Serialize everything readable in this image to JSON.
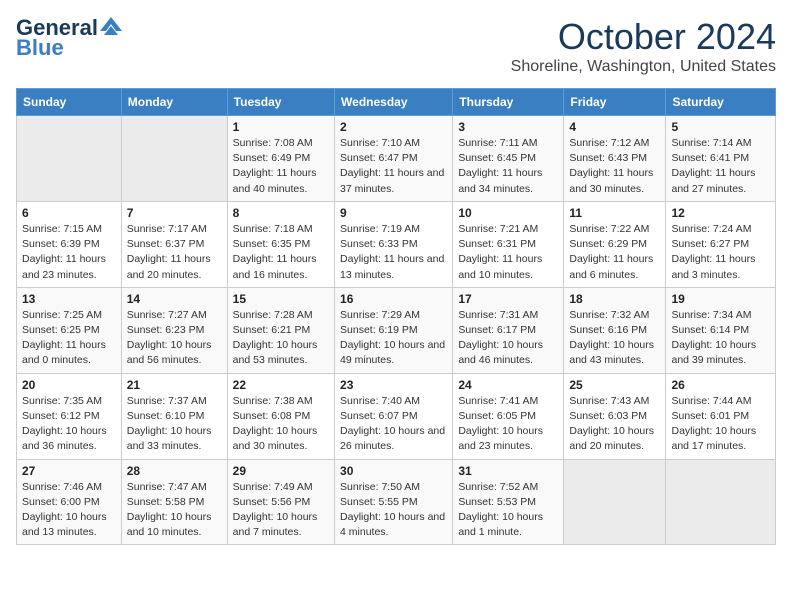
{
  "logo": {
    "line1": "General",
    "line2": "Blue"
  },
  "title": "October 2024",
  "subtitle": "Shoreline, Washington, United States",
  "days_of_week": [
    "Sunday",
    "Monday",
    "Tuesday",
    "Wednesday",
    "Thursday",
    "Friday",
    "Saturday"
  ],
  "weeks": [
    [
      {
        "day": "",
        "info": ""
      },
      {
        "day": "",
        "info": ""
      },
      {
        "day": "1",
        "info": "Sunrise: 7:08 AM\nSunset: 6:49 PM\nDaylight: 11 hours and 40 minutes."
      },
      {
        "day": "2",
        "info": "Sunrise: 7:10 AM\nSunset: 6:47 PM\nDaylight: 11 hours and 37 minutes."
      },
      {
        "day": "3",
        "info": "Sunrise: 7:11 AM\nSunset: 6:45 PM\nDaylight: 11 hours and 34 minutes."
      },
      {
        "day": "4",
        "info": "Sunrise: 7:12 AM\nSunset: 6:43 PM\nDaylight: 11 hours and 30 minutes."
      },
      {
        "day": "5",
        "info": "Sunrise: 7:14 AM\nSunset: 6:41 PM\nDaylight: 11 hours and 27 minutes."
      }
    ],
    [
      {
        "day": "6",
        "info": "Sunrise: 7:15 AM\nSunset: 6:39 PM\nDaylight: 11 hours and 23 minutes."
      },
      {
        "day": "7",
        "info": "Sunrise: 7:17 AM\nSunset: 6:37 PM\nDaylight: 11 hours and 20 minutes."
      },
      {
        "day": "8",
        "info": "Sunrise: 7:18 AM\nSunset: 6:35 PM\nDaylight: 11 hours and 16 minutes."
      },
      {
        "day": "9",
        "info": "Sunrise: 7:19 AM\nSunset: 6:33 PM\nDaylight: 11 hours and 13 minutes."
      },
      {
        "day": "10",
        "info": "Sunrise: 7:21 AM\nSunset: 6:31 PM\nDaylight: 11 hours and 10 minutes."
      },
      {
        "day": "11",
        "info": "Sunrise: 7:22 AM\nSunset: 6:29 PM\nDaylight: 11 hours and 6 minutes."
      },
      {
        "day": "12",
        "info": "Sunrise: 7:24 AM\nSunset: 6:27 PM\nDaylight: 11 hours and 3 minutes."
      }
    ],
    [
      {
        "day": "13",
        "info": "Sunrise: 7:25 AM\nSunset: 6:25 PM\nDaylight: 11 hours and 0 minutes."
      },
      {
        "day": "14",
        "info": "Sunrise: 7:27 AM\nSunset: 6:23 PM\nDaylight: 10 hours and 56 minutes."
      },
      {
        "day": "15",
        "info": "Sunrise: 7:28 AM\nSunset: 6:21 PM\nDaylight: 10 hours and 53 minutes."
      },
      {
        "day": "16",
        "info": "Sunrise: 7:29 AM\nSunset: 6:19 PM\nDaylight: 10 hours and 49 minutes."
      },
      {
        "day": "17",
        "info": "Sunrise: 7:31 AM\nSunset: 6:17 PM\nDaylight: 10 hours and 46 minutes."
      },
      {
        "day": "18",
        "info": "Sunrise: 7:32 AM\nSunset: 6:16 PM\nDaylight: 10 hours and 43 minutes."
      },
      {
        "day": "19",
        "info": "Sunrise: 7:34 AM\nSunset: 6:14 PM\nDaylight: 10 hours and 39 minutes."
      }
    ],
    [
      {
        "day": "20",
        "info": "Sunrise: 7:35 AM\nSunset: 6:12 PM\nDaylight: 10 hours and 36 minutes."
      },
      {
        "day": "21",
        "info": "Sunrise: 7:37 AM\nSunset: 6:10 PM\nDaylight: 10 hours and 33 minutes."
      },
      {
        "day": "22",
        "info": "Sunrise: 7:38 AM\nSunset: 6:08 PM\nDaylight: 10 hours and 30 minutes."
      },
      {
        "day": "23",
        "info": "Sunrise: 7:40 AM\nSunset: 6:07 PM\nDaylight: 10 hours and 26 minutes."
      },
      {
        "day": "24",
        "info": "Sunrise: 7:41 AM\nSunset: 6:05 PM\nDaylight: 10 hours and 23 minutes."
      },
      {
        "day": "25",
        "info": "Sunrise: 7:43 AM\nSunset: 6:03 PM\nDaylight: 10 hours and 20 minutes."
      },
      {
        "day": "26",
        "info": "Sunrise: 7:44 AM\nSunset: 6:01 PM\nDaylight: 10 hours and 17 minutes."
      }
    ],
    [
      {
        "day": "27",
        "info": "Sunrise: 7:46 AM\nSunset: 6:00 PM\nDaylight: 10 hours and 13 minutes."
      },
      {
        "day": "28",
        "info": "Sunrise: 7:47 AM\nSunset: 5:58 PM\nDaylight: 10 hours and 10 minutes."
      },
      {
        "day": "29",
        "info": "Sunrise: 7:49 AM\nSunset: 5:56 PM\nDaylight: 10 hours and 7 minutes."
      },
      {
        "day": "30",
        "info": "Sunrise: 7:50 AM\nSunset: 5:55 PM\nDaylight: 10 hours and 4 minutes."
      },
      {
        "day": "31",
        "info": "Sunrise: 7:52 AM\nSunset: 5:53 PM\nDaylight: 10 hours and 1 minute."
      },
      {
        "day": "",
        "info": ""
      },
      {
        "day": "",
        "info": ""
      }
    ]
  ]
}
